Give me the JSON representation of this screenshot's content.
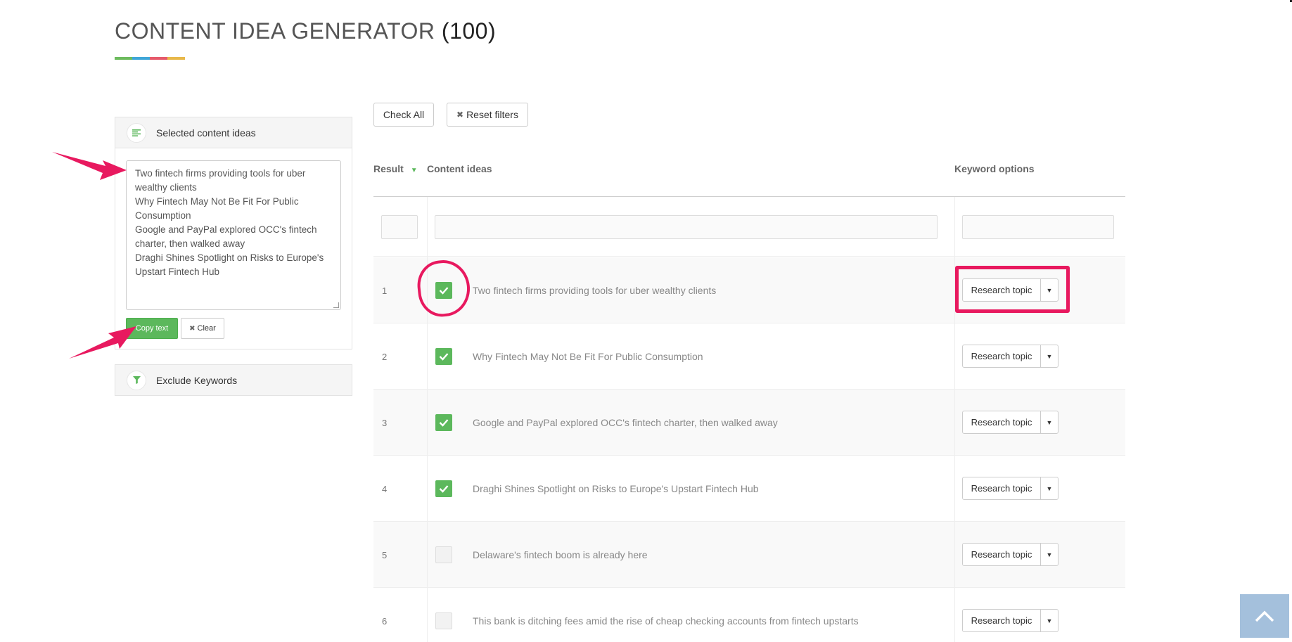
{
  "page": {
    "title": "CONTENT IDEA GENERATOR",
    "count": "(100)",
    "title_bar_colors": [
      "#6dbb5e",
      "#3fa6d8",
      "#e55a6b",
      "#e8b84a"
    ]
  },
  "selected_panel": {
    "heading": "Selected content ideas",
    "icon": "align-left-icon",
    "text": "Two fintech firms providing tools for uber wealthy clients\nWhy Fintech May Not Be Fit For Public Consumption\nGoogle and PayPal explored OCC's fintech charter, then walked away\nDraghi Shines Spotlight on Risks to Europe's Upstart Fintech Hub",
    "copy_label": "Copy text",
    "clear_label": "Clear"
  },
  "exclude_panel": {
    "heading": "Exclude Keywords",
    "icon": "filter-icon"
  },
  "toolbar": {
    "check_all": "Check All",
    "reset_filters": "Reset filters"
  },
  "table": {
    "headers": {
      "result": "Result",
      "content": "Content ideas",
      "keyword": "Keyword options"
    },
    "rows": [
      {
        "num": "1",
        "checked": true,
        "idea": "Two fintech firms providing tools for uber wealthy clients",
        "action": "Research topic"
      },
      {
        "num": "2",
        "checked": true,
        "idea": "Why Fintech May Not Be Fit For Public Consumption",
        "action": "Research topic"
      },
      {
        "num": "3",
        "checked": true,
        "idea": "Google and PayPal explored OCC's fintech charter, then walked away",
        "action": "Research topic"
      },
      {
        "num": "4",
        "checked": true,
        "idea": "Draghi Shines Spotlight on Risks to Europe's Upstart Fintech Hub",
        "action": "Research topic"
      },
      {
        "num": "5",
        "checked": false,
        "idea": "Delaware's fintech boom is already here",
        "action": "Research topic"
      },
      {
        "num": "6",
        "checked": false,
        "idea": "This bank is ditching fees amid the rise of cheap checking accounts from fintech upstarts",
        "action": "Research topic"
      }
    ]
  },
  "colors": {
    "accent": "#5cb85c",
    "annotation": "#e8195f",
    "back_to_top": "#a4c0dc"
  }
}
